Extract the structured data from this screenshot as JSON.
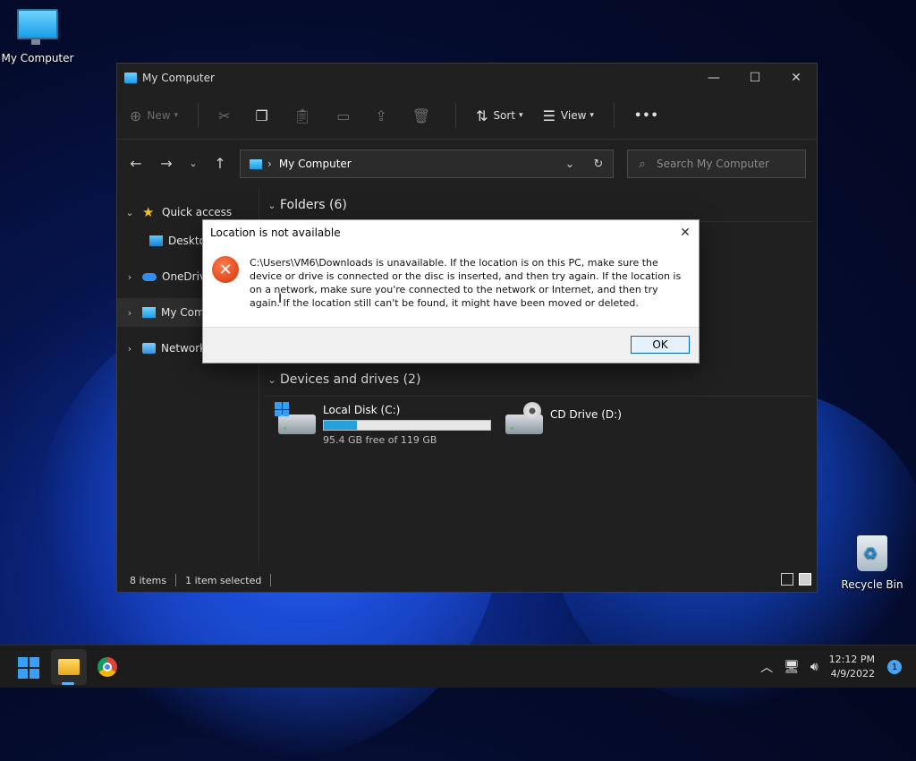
{
  "desktop": {
    "my_computer_label": "My Computer",
    "recycle_bin_label": "Recycle Bin"
  },
  "window": {
    "title": "My Computer",
    "controls": {
      "minimize": "—",
      "maximize": "☐",
      "close": "✕"
    }
  },
  "toolbar": {
    "new_label": "New",
    "sort_label": "Sort",
    "view_label": "View",
    "more_label": "•••"
  },
  "address": {
    "crumb": "My Computer",
    "search_placeholder": "Search My Computer"
  },
  "sidebar": {
    "items": [
      {
        "label": "Quick access"
      },
      {
        "label": "Desktop"
      },
      {
        "label": "OneDrive"
      },
      {
        "label": "My Computer"
      },
      {
        "label": "Network"
      }
    ]
  },
  "content": {
    "folders_header": "Folders (6)",
    "devices_header": "Devices and drives (2)",
    "drives": [
      {
        "name": "Local Disk (C:)",
        "free_text": "95.4 GB free of 119 GB",
        "used_fraction": 0.2
      },
      {
        "name": "CD Drive (D:)"
      }
    ]
  },
  "status": {
    "items": "8 items",
    "selected": "1 item selected"
  },
  "dialog": {
    "title": "Location is not available",
    "message": "C:\\Users\\VM6\\Downloads is unavailable. If the location is on this PC, make sure the device or drive is connected or the disc is inserted, and then try again. If the location is on a network, make sure you're connected to the network or Internet, and then try again. If the location still can't be found, it might have been moved or deleted.",
    "ok_label": "OK",
    "close_glyph": "✕"
  },
  "taskbar": {
    "time": "12:12 PM",
    "date": "4/9/2022",
    "notification_count": "1"
  },
  "colors": {
    "accent": "#0067c0",
    "drive_bar": "#26a0da",
    "error_icon": "#d2350f"
  }
}
